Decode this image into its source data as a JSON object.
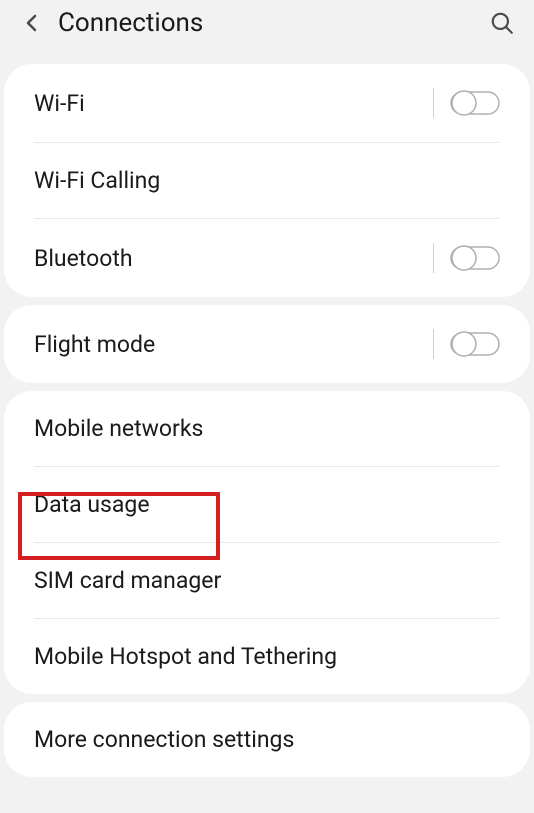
{
  "header": {
    "title": "Connections"
  },
  "group1": {
    "items": [
      {
        "label": "Wi-Fi",
        "hasSwitch": true
      },
      {
        "label": "Wi-Fi Calling",
        "hasSwitch": false
      },
      {
        "label": "Bluetooth",
        "hasSwitch": true
      }
    ]
  },
  "group2": {
    "items": [
      {
        "label": "Flight mode",
        "hasSwitch": true
      }
    ]
  },
  "group3": {
    "items": [
      {
        "label": "Mobile networks",
        "hasSwitch": false
      },
      {
        "label": "Data usage",
        "hasSwitch": false
      },
      {
        "label": "SIM card manager",
        "hasSwitch": false
      },
      {
        "label": "Mobile Hotspot and Tethering",
        "hasSwitch": false
      }
    ]
  },
  "group4": {
    "items": [
      {
        "label": "More connection settings",
        "hasSwitch": false
      }
    ]
  }
}
